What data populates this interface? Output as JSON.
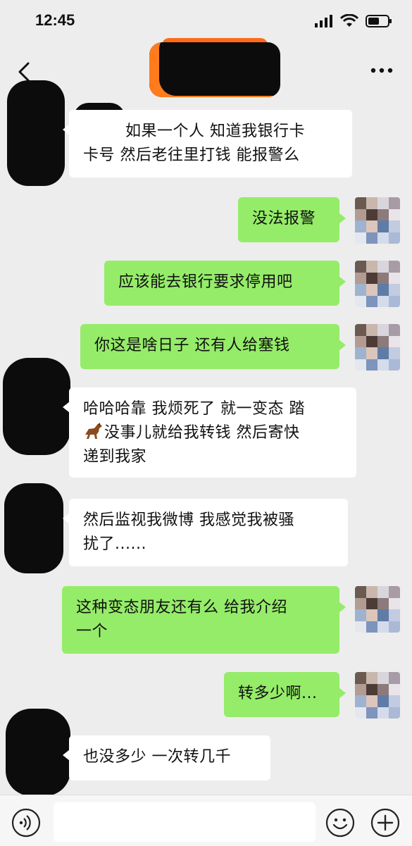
{
  "status_bar": {
    "time": "12:45",
    "icons": [
      "signal-icon",
      "wifi-icon",
      "battery-icon"
    ]
  },
  "nav": {
    "back_icon": "chevron-left-icon",
    "more_icon": "more-dots-icon",
    "title": ""
  },
  "messages": [
    {
      "from": "them",
      "text_line1": "如果一个人 知道我银行卡",
      "text_line2": "卡号 然后老往里打钱 能报警么"
    },
    {
      "from": "me",
      "text": "没法报警"
    },
    {
      "from": "me",
      "text": "应该能去银行要求停用吧"
    },
    {
      "from": "me",
      "text": "你这是啥日子 还有人给塞钱"
    },
    {
      "from": "them",
      "text_line1": "哈哈哈靠 我烦死了 就一变态 踏",
      "text_line2_emoji": "horse-emoji",
      "text_line2": "没事儿就给我转钱 然后寄快",
      "text_line3": "递到我家"
    },
    {
      "from": "them",
      "text_line1": "然后监视我微博 我感觉我被骚",
      "text_line2": "扰了......"
    },
    {
      "from": "me",
      "text_line1": "这种变态朋友还有么 给我介绍",
      "text_line2": "一个"
    },
    {
      "from": "me",
      "text": "转多少啊..."
    },
    {
      "from": "them",
      "text": "也没多少 一次转几千"
    }
  ],
  "input_bar": {
    "voice_icon": "voice-icon",
    "input_value": "",
    "emoji_icon": "emoji-icon",
    "plus_icon": "plus-icon"
  },
  "colors": {
    "background": "#ededed",
    "incoming_bubble": "#ffffff",
    "outgoing_bubble": "#95ec69",
    "redaction": "#0c0c0c"
  }
}
